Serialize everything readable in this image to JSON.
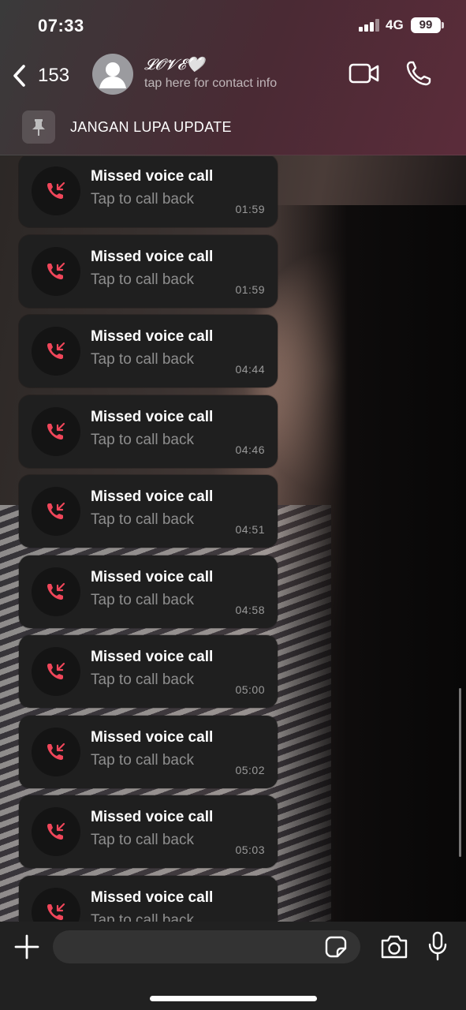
{
  "status_bar": {
    "time": "07:33",
    "network": "4G",
    "battery": "99"
  },
  "header": {
    "back_count": "153",
    "contact_name": "𝓛𝓞𝓥𝓔🤍",
    "contact_subtitle": "tap here for contact info"
  },
  "pinned": {
    "text": "JANGAN LUPA UPDATE"
  },
  "messages": [
    {
      "title": "Missed voice call",
      "subtitle": "Tap to call back",
      "time": "01:59"
    },
    {
      "title": "Missed voice call",
      "subtitle": "Tap to call back",
      "time": "01:59"
    },
    {
      "title": "Missed voice call",
      "subtitle": "Tap to call back",
      "time": "04:44"
    },
    {
      "title": "Missed voice call",
      "subtitle": "Tap to call back",
      "time": "04:46"
    },
    {
      "title": "Missed voice call",
      "subtitle": "Tap to call back",
      "time": "04:51"
    },
    {
      "title": "Missed voice call",
      "subtitle": "Tap to call back",
      "time": "04:58"
    },
    {
      "title": "Missed voice call",
      "subtitle": "Tap to call back",
      "time": "05:00"
    },
    {
      "title": "Missed voice call",
      "subtitle": "Tap to call back",
      "time": "05:02"
    },
    {
      "title": "Missed voice call",
      "subtitle": "Tap to call back",
      "time": "05:03"
    },
    {
      "title": "Missed voice call",
      "subtitle": "Tap to call back",
      "time": ""
    }
  ],
  "composer": {
    "placeholder": ""
  },
  "colors": {
    "missed_call_red": "#f0465a",
    "bubble": "#1f1f1f",
    "header_tint": "#5b2c3a"
  },
  "icons": [
    "back-chevron-icon",
    "avatar-placeholder-icon",
    "video-call-icon",
    "phone-icon",
    "pin-icon",
    "missed-call-icon",
    "plus-icon",
    "sticker-icon",
    "camera-icon",
    "microphone-icon"
  ]
}
